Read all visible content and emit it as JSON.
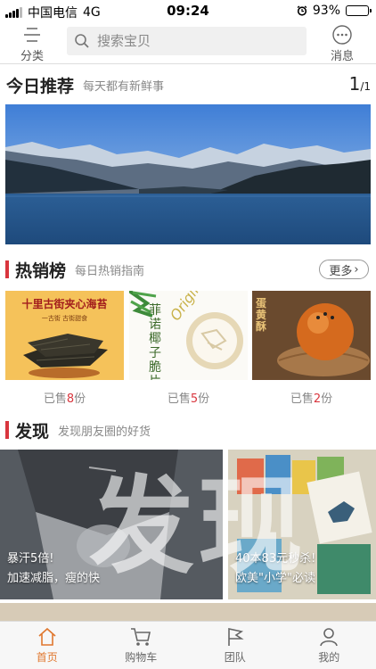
{
  "status_bar": {
    "carrier": "中国电信",
    "network": "4G",
    "time": "09:24",
    "battery": "93%",
    "battery_level": 0.93
  },
  "top_bar": {
    "category_label": "分类",
    "search_placeholder": "搜索宝贝",
    "message_label": "消息"
  },
  "today": {
    "title": "今日推荐",
    "subtitle": "每天都有新鲜事",
    "page_current": "1",
    "page_total": "/1"
  },
  "hot": {
    "title": "热销榜",
    "subtitle": "每日热销指南",
    "more_label": "更多",
    "items": [
      {
        "img_text": "十里古街夹心海苔",
        "brand": "一古街 古街甜食",
        "sold_prefix": "已售",
        "sold_count": "8",
        "sold_unit": "份"
      },
      {
        "img_text": "菲诺椰子脆片",
        "img_script": "Original",
        "sold_prefix": "已售",
        "sold_count": "5",
        "sold_unit": "份"
      },
      {
        "img_text": "蛋黄酥",
        "sold_prefix": "已售",
        "sold_count": "2",
        "sold_unit": "份"
      }
    ]
  },
  "discover": {
    "title": "发现",
    "subtitle": "发现朋友圈的好货",
    "overlay_text": "发现",
    "cards": [
      {
        "line1": "暴汗5倍!",
        "line2": "加速减脂，瘦的快"
      },
      {
        "line1": "40本83元秒杀!",
        "line2": "欧美\"小学\"必读"
      }
    ]
  },
  "tabs": [
    {
      "label": "首页",
      "icon": "home-icon"
    },
    {
      "label": "购物车",
      "icon": "cart-icon"
    },
    {
      "label": "团队",
      "icon": "flag-icon"
    },
    {
      "label": "我的",
      "icon": "user-icon"
    }
  ],
  "colors": {
    "accent": "#d9363e",
    "tab_active": "#e0772e"
  }
}
